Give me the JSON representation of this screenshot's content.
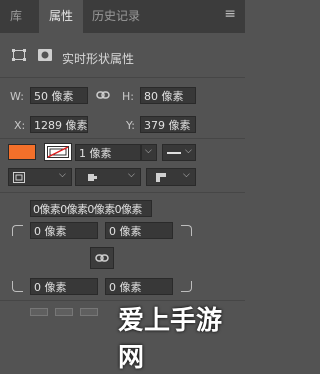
{
  "tabs": [
    {
      "label": "库"
    },
    {
      "label": "属性"
    },
    {
      "label": "历史记录"
    }
  ],
  "header": {
    "title": "实时形状属性"
  },
  "size": {
    "w_label": "W:",
    "w_value": "50 像素",
    "h_label": "H:",
    "h_value": "80 像素"
  },
  "position": {
    "x_label": "X:",
    "x_value": "1289 像素",
    "y_label": "Y:",
    "y_value": "379 像素"
  },
  "stroke": {
    "fill_color": "#f4702a",
    "width_value": "1 像素"
  },
  "corners": {
    "all_value": "0像素0像素0像素0像素",
    "top_left": "0 像素",
    "top_right": "0 像素",
    "bottom_left": "0 像素",
    "bottom_right": "0 像素"
  },
  "watermark": "爱上手游网"
}
